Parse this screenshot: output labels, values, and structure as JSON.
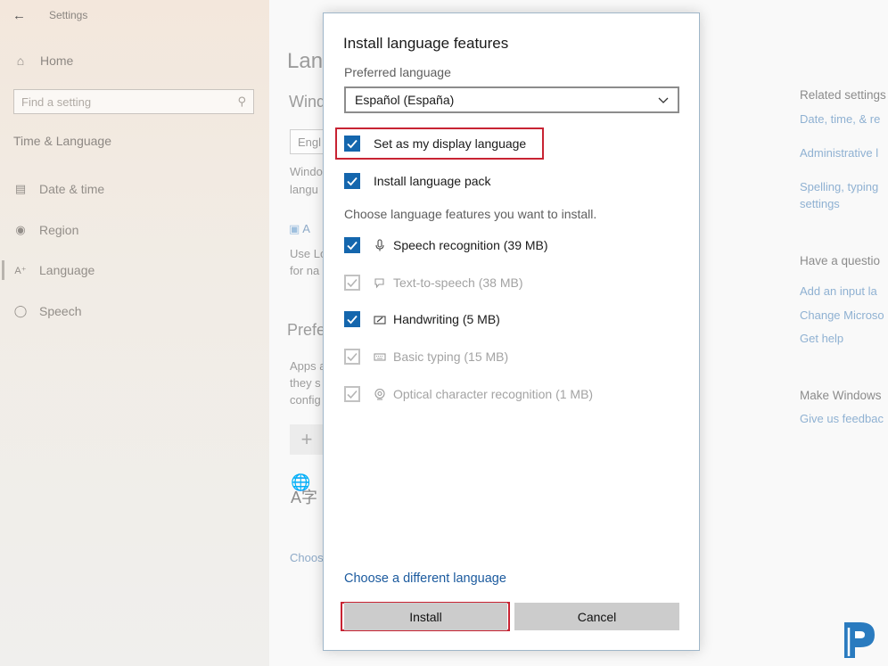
{
  "background": {
    "window_title": "Settings",
    "sidebar": {
      "home": "Home",
      "search_placeholder": "Find a setting",
      "section": "Time & Language",
      "items": [
        {
          "label": "Date & time",
          "icon": "calendar-icon"
        },
        {
          "label": "Region",
          "icon": "globe-icon"
        },
        {
          "label": "Language",
          "icon": "language-icon"
        },
        {
          "label": "Speech",
          "icon": "microphone-icon"
        }
      ]
    },
    "main_fragments": {
      "title": "Lan",
      "subtitle": "Wind",
      "combo": "Engl",
      "desc1": "Windo",
      "desc2": "langu",
      "add_link": "A",
      "use1": "Use Lo",
      "use2": "for na",
      "preferred": "Prefe",
      "apps1": "Apps a",
      "apps2": "they s",
      "apps3": "config",
      "plus": "+",
      "choose": "Choos"
    },
    "right_column": {
      "related_heading": "Related settings",
      "related_links": [
        "Date, time, & re",
        "Administrative l",
        "Spelling, typing",
        "settings"
      ],
      "question_heading": "Have a questio",
      "question_links": [
        "Add an input la",
        "Change Microso",
        "Get help"
      ],
      "make_heading": "Make Windows",
      "make_link": "Give us feedbac"
    }
  },
  "dialog": {
    "title": "Install language features",
    "preferred_label": "Preferred language",
    "selected_language": "Español (España)",
    "options": {
      "display_language": {
        "label": "Set as my display language",
        "checked": true
      },
      "language_pack": {
        "label": "Install language pack",
        "checked": true
      }
    },
    "features_hint": "Choose language features you want to install.",
    "features": [
      {
        "label": "Speech recognition (39 MB)",
        "checked": true,
        "enabled": true,
        "icon": "microphone-icon"
      },
      {
        "label": "Text-to-speech (38 MB)",
        "checked": true,
        "enabled": false,
        "icon": "speech-bubble-icon"
      },
      {
        "label": "Handwriting (5 MB)",
        "checked": true,
        "enabled": true,
        "icon": "pen-icon"
      },
      {
        "label": "Basic typing (15 MB)",
        "checked": true,
        "enabled": false,
        "icon": "keyboard-icon"
      },
      {
        "label": "Optical character recognition (1 MB)",
        "checked": true,
        "enabled": false,
        "icon": "ocr-icon"
      }
    ],
    "choose_link": "Choose a different language",
    "install_label": "Install",
    "cancel_label": "Cancel"
  },
  "colors": {
    "accent": "#1466ad",
    "link": "#1b5a9e",
    "highlight": "#c82333",
    "logo": "#2a7bbf"
  },
  "logo": {
    "letter": "P",
    "icon": "brand-logo-icon"
  }
}
